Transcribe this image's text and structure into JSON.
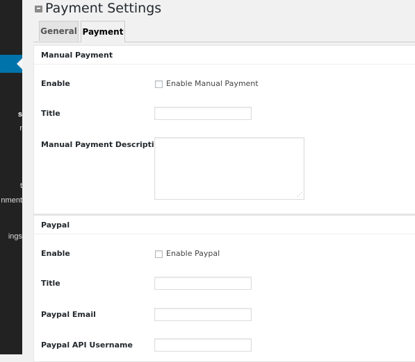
{
  "sidebar": {
    "fragments": [
      "t",
      "s",
      "r",
      "t",
      "nment",
      "ings"
    ]
  },
  "page": {
    "title": "Payment Settings",
    "icon": "settings-box-icon"
  },
  "tabs": [
    {
      "label": "General",
      "active": false
    },
    {
      "label": "Payment",
      "active": true
    }
  ],
  "manual_payment": {
    "heading": "Manual Payment",
    "enable_label": "Enable",
    "enable_checkbox_label": "Enable Manual Payment",
    "enable_checked": false,
    "title_label": "Title",
    "title_value": "",
    "description_label": "Manual Payment Description",
    "description_value": ""
  },
  "paypal": {
    "heading": "Paypal",
    "enable_label": "Enable",
    "enable_checkbox_label": "Enable Paypal",
    "enable_checked": false,
    "title_label": "Title",
    "title_value": "",
    "email_label": "Paypal Email",
    "email_value": "",
    "api_username_label": "Paypal API Username",
    "api_username_value": ""
  },
  "colors": {
    "sidebar_bg": "#222222",
    "sidebar_active": "#0073aa",
    "page_bg": "#f1f1f1"
  }
}
